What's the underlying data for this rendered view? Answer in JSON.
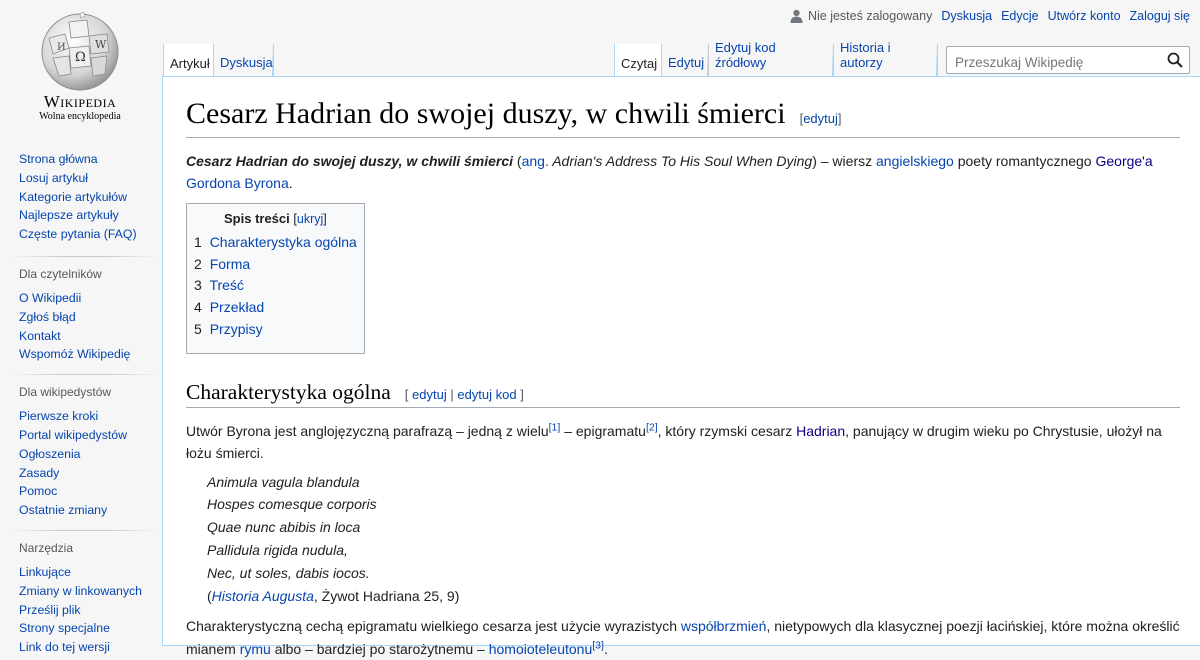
{
  "logo": {
    "wordmark": "Wikipedia",
    "tagline": "Wolna encyklopedia"
  },
  "personal": {
    "anon": "Nie jesteś zalogowany",
    "links": [
      "Dyskusja",
      "Edycje",
      "Utwórz konto",
      "Zaloguj się"
    ]
  },
  "tabs": {
    "article": "Artykuł",
    "talk": "Dyskusja",
    "read": "Czytaj",
    "edit": "Edytuj",
    "edit_source": "Edytuj kod źródłowy",
    "history": "Historia i autorzy"
  },
  "search": {
    "placeholder": "Przeszukaj Wikipedię"
  },
  "sidebar": {
    "main": [
      "Strona główna",
      "Losuj artykuł",
      "Kategorie artykułów",
      "Najlepsze artykuły",
      "Częste pytania (FAQ)"
    ],
    "readers": {
      "heading": "Dla czytelników",
      "items": [
        "O Wikipedii",
        "Zgłoś błąd",
        "Kontakt",
        "Wspomóż Wikipedię"
      ]
    },
    "editors": {
      "heading": "Dla wikipedystów",
      "items": [
        "Pierwsze kroki",
        "Portal wikipedystów",
        "Ogłoszenia",
        "Zasady",
        "Pomoc",
        "Ostatnie zmiany"
      ]
    },
    "tools": {
      "heading": "Narzędzia",
      "items": [
        "Linkujące",
        "Zmiany w linkowanych",
        "Prześlij plik",
        "Strony specjalne",
        "Link do tej wersji"
      ]
    }
  },
  "article": {
    "title": "Cesarz Hadrian do swojej duszy, w chwili śmierci",
    "title_edit": "edytuj",
    "intro": {
      "bold_title": "Cesarz Hadrian do swojej duszy, w chwili śmierci",
      "paren_open": " (",
      "lang_link": "ang.",
      "orig_title": " Adrian's Address To His Soul When Dying",
      "after_orig": ") – wiersz ",
      "link_english": "angielskiego",
      "mid": " poety romantycznego ",
      "link_author_a": "George'a",
      "link_author_b": " Gordona Byrona",
      "end": "."
    },
    "toc": {
      "title": "Spis treści",
      "toggle": "ukryj",
      "items": [
        {
          "num": "1",
          "label": "Charakterystyka ogólna"
        },
        {
          "num": "2",
          "label": "Forma"
        },
        {
          "num": "3",
          "label": "Treść"
        },
        {
          "num": "4",
          "label": "Przekład"
        },
        {
          "num": "5",
          "label": "Przypisy"
        }
      ]
    },
    "section1": {
      "heading": "Charakterystyka ogólna",
      "edit": "edytuj",
      "edit_source": "edytuj kod",
      "p1": {
        "t1": "Utwór Byrona jest anglojęzyczną parafrazą – jedną z wielu",
        "ref1": "[1]",
        "t2": " – epigramatu",
        "ref2": "[2]",
        "t3": ", który rzymski cesarz ",
        "link_hadrian": "Hadrian",
        "t4": ", panujący w drugim wieku po Chrystusie, ułożył na łożu śmierci."
      },
      "poem": [
        "Animula vagula blandula",
        "Hospes comesque corporis",
        "Quae nunc abibis in loca",
        "Pallidula rigida nudula,",
        "Nec, ut soles, dabis iocos."
      ],
      "source": {
        "open": "(",
        "link": "Historia Augusta",
        "rest": ", Żywot Hadriana 25, 9)"
      },
      "p2": {
        "t1": "Charakterystyczną cechą epigramatu wielkiego cesarza jest użycie wyrazistych ",
        "link1": "współbrzmień",
        "t2": ", nietypowych dla klasycznej poezji łacińskiej, które można określić mianem ",
        "link2": "rymu",
        "t3": " albo – bardziej po starożytnemu – ",
        "link3": "homoioteleutonu",
        "ref3": "[3]",
        "t4": "."
      }
    }
  }
}
